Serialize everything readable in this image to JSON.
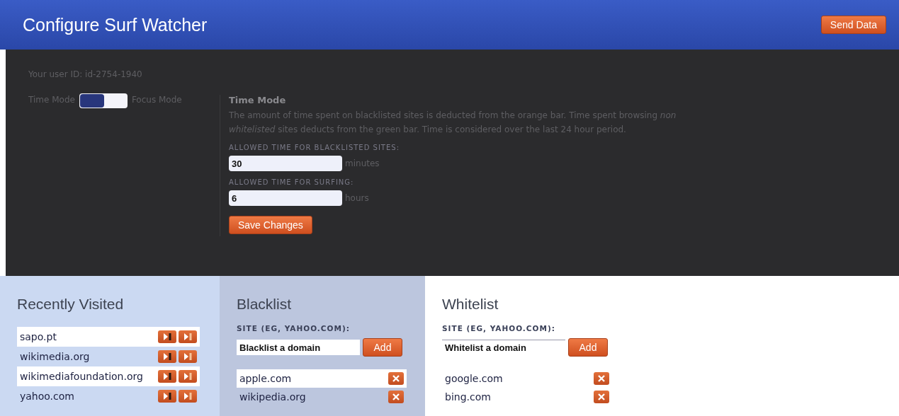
{
  "header": {
    "title": "Configure Surf Watcher",
    "send_button": "Send Data"
  },
  "settings": {
    "user_id": "Your user ID: id-2754-1940",
    "mode_toggle": {
      "left_label": "Time Mode",
      "right_label": "Focus Mode",
      "focus_mode_on": false
    },
    "mode_title": "Time Mode",
    "description": "The amount of time spent on blacklisted sites is deducted from the orange bar. Time spent browsing *non whitelisted* sites deducts from the green bar. Time is considered over the last 24 hour period.",
    "fields": [
      {
        "label": "ALLOWED TIME FOR BLACKLISTED SITES:",
        "value": "30",
        "unit": "minutes"
      },
      {
        "label": "ALLOWED TIME FOR SURFING:",
        "value": "6",
        "unit": "hours"
      }
    ],
    "save_button": "Save Changes"
  },
  "recently_visited": {
    "title": "Recently Visited",
    "items": [
      {
        "site": "sapo.pt"
      },
      {
        "site": "wikimedia.org"
      },
      {
        "site": "wikimediafoundation.org"
      },
      {
        "site": "yahoo.com"
      }
    ]
  },
  "blacklist": {
    "title": "Blacklist",
    "field_label": "SITE (EG, YAHOO.COM):",
    "placeholder": "Blacklist a domain",
    "add_button": "Add",
    "items": [
      {
        "site": "apple.com"
      },
      {
        "site": "wikipedia.org"
      }
    ]
  },
  "whitelist": {
    "title": "Whitelist",
    "field_label": "SITE (EG, YAHOO.COM):",
    "placeholder": "Whitelist a domain",
    "add_button": "Add",
    "items": [
      {
        "site": "google.com"
      },
      {
        "site": "bing.com"
      }
    ]
  }
}
